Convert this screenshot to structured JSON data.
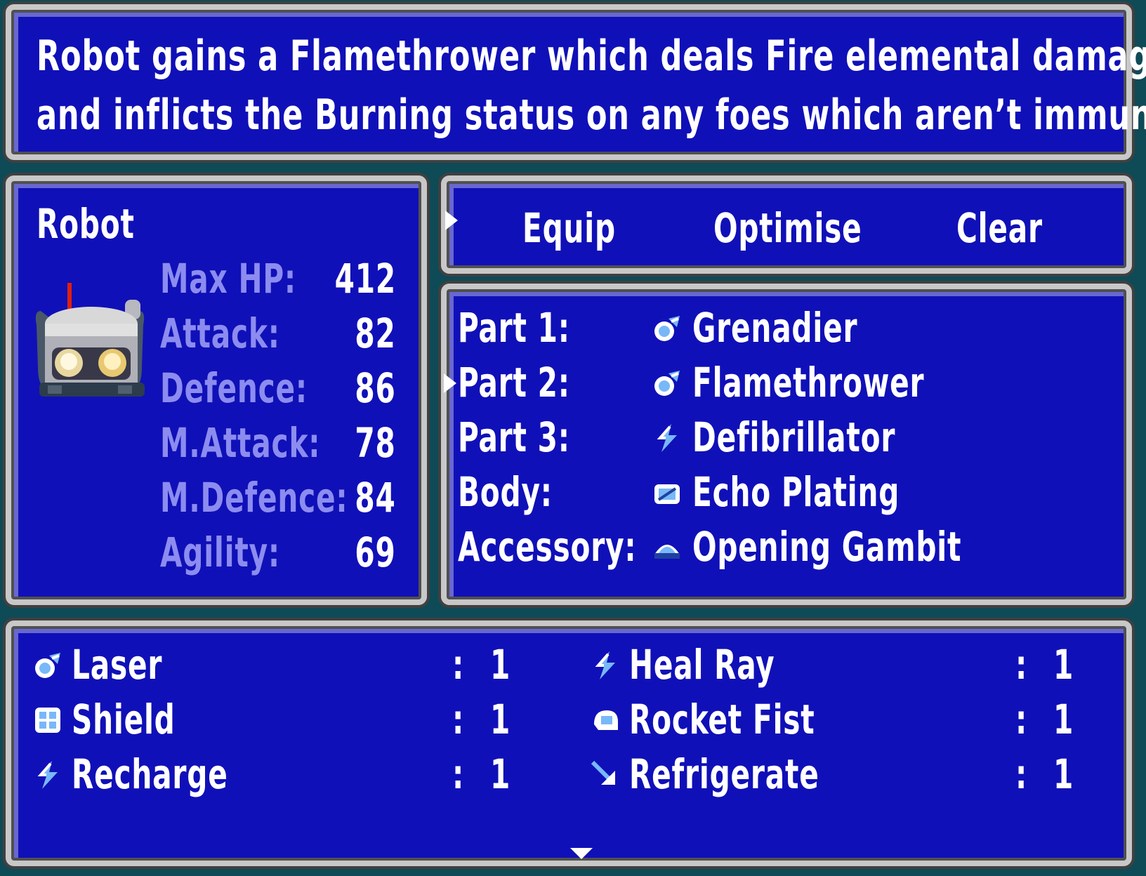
{
  "description": {
    "line1": "Robot gains a Flamethrower which deals Fire elemental damage,",
    "line2": "and inflicts the Burning status on any foes which aren’t immune."
  },
  "character": {
    "name": "Robot",
    "stats": [
      {
        "label": "Max HP:",
        "value": "412"
      },
      {
        "label": "Attack:",
        "value": "82"
      },
      {
        "label": "Defence:",
        "value": "86"
      },
      {
        "label": "M.Attack:",
        "value": "78"
      },
      {
        "label": "M.Defence:",
        "value": "84"
      },
      {
        "label": "Agility:",
        "value": "69"
      }
    ]
  },
  "commands": {
    "equip": "Equip",
    "optimise": "Optimise",
    "clear": "Clear"
  },
  "slots": [
    {
      "slot": "Part 1:",
      "icon": "weapon-part-icon",
      "item": "Grenadier"
    },
    {
      "slot": "Part 2:",
      "icon": "weapon-part-icon",
      "item": "Flamethrower"
    },
    {
      "slot": "Part 3:",
      "icon": "lightning-part-icon",
      "item": "Defibrillator"
    },
    {
      "slot": "Body:",
      "icon": "armor-body-icon",
      "item": "Echo Plating"
    },
    {
      "slot": "Accessory:",
      "icon": "accessory-icon",
      "item": "Opening Gambit"
    }
  ],
  "inventory": [
    {
      "icon": "weapon-part-icon",
      "name": "Laser",
      "sep": ":",
      "count": "1"
    },
    {
      "icon": "lightning-part-icon",
      "name": "Heal Ray",
      "sep": ":",
      "count": "1"
    },
    {
      "icon": "shield-part-icon",
      "name": "Shield",
      "sep": ":",
      "count": "1"
    },
    {
      "icon": "fist-part-icon",
      "name": "Rocket Fist",
      "sep": ":",
      "count": "1"
    },
    {
      "icon": "lightning-part-icon",
      "name": "Recharge",
      "sep": ":",
      "count": "1"
    },
    {
      "icon": "ice-arrow-icon",
      "name": "Refrigerate",
      "sep": ":",
      "count": "1"
    }
  ],
  "colors": {
    "window_bg": "#1010b8",
    "border": "#c8c8c8",
    "stat_label": "#8c8cf0",
    "text": "#ffffff"
  }
}
